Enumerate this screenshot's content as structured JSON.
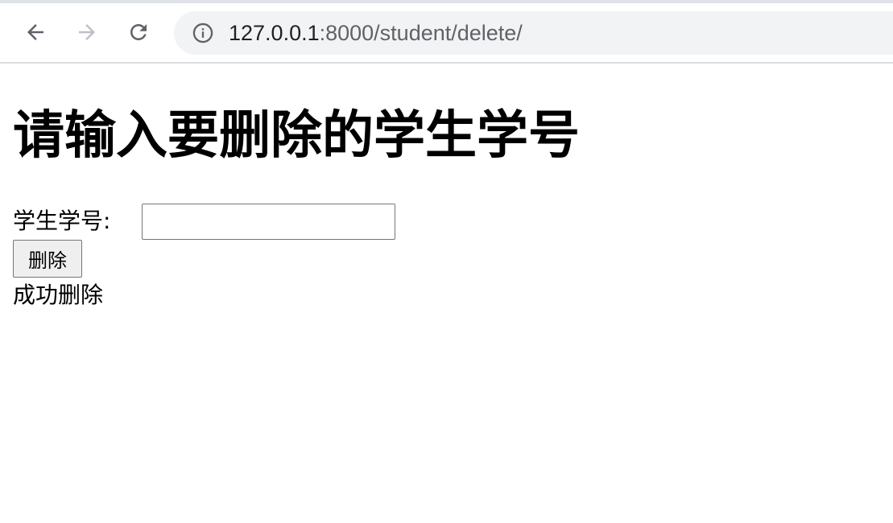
{
  "browser": {
    "url_host": "127.0.0.1",
    "url_rest": ":8000/student/delete/"
  },
  "icons": {
    "back": "back-arrow-icon",
    "forward": "forward-arrow-icon",
    "reload": "reload-icon",
    "info": "info-icon"
  },
  "page": {
    "heading": "请输入要删除的学生学号",
    "field_label": "学生学号:",
    "field_value": "",
    "button_label": "删除",
    "result_message": "成功删除"
  },
  "colors": {
    "omnibox_bg": "#f1f3f4",
    "forward_disabled": "#bdc1c6",
    "icon_active": "#5f6368"
  }
}
